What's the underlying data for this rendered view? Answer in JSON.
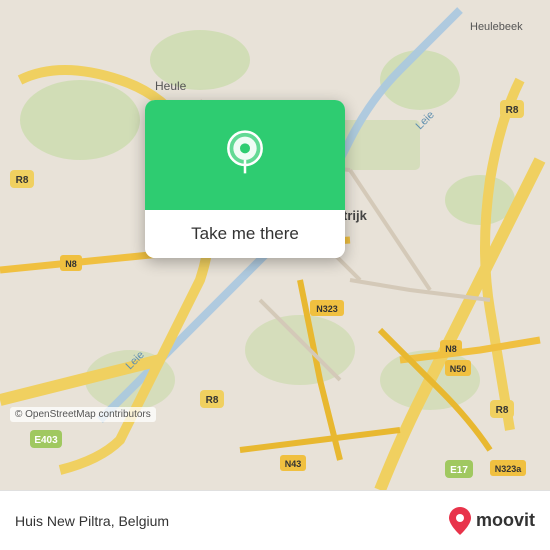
{
  "map": {
    "attribution": "© OpenStreetMap contributors",
    "center_lat": 50.824,
    "center_lon": 3.264
  },
  "popup": {
    "button_label": "Take me there"
  },
  "bottom_bar": {
    "location_name": "Huis New Piltra, Belgium",
    "brand": "moovit"
  },
  "icons": {
    "pin": "location-pin-icon",
    "moovit_pin": "moovit-logo-pin-icon"
  }
}
